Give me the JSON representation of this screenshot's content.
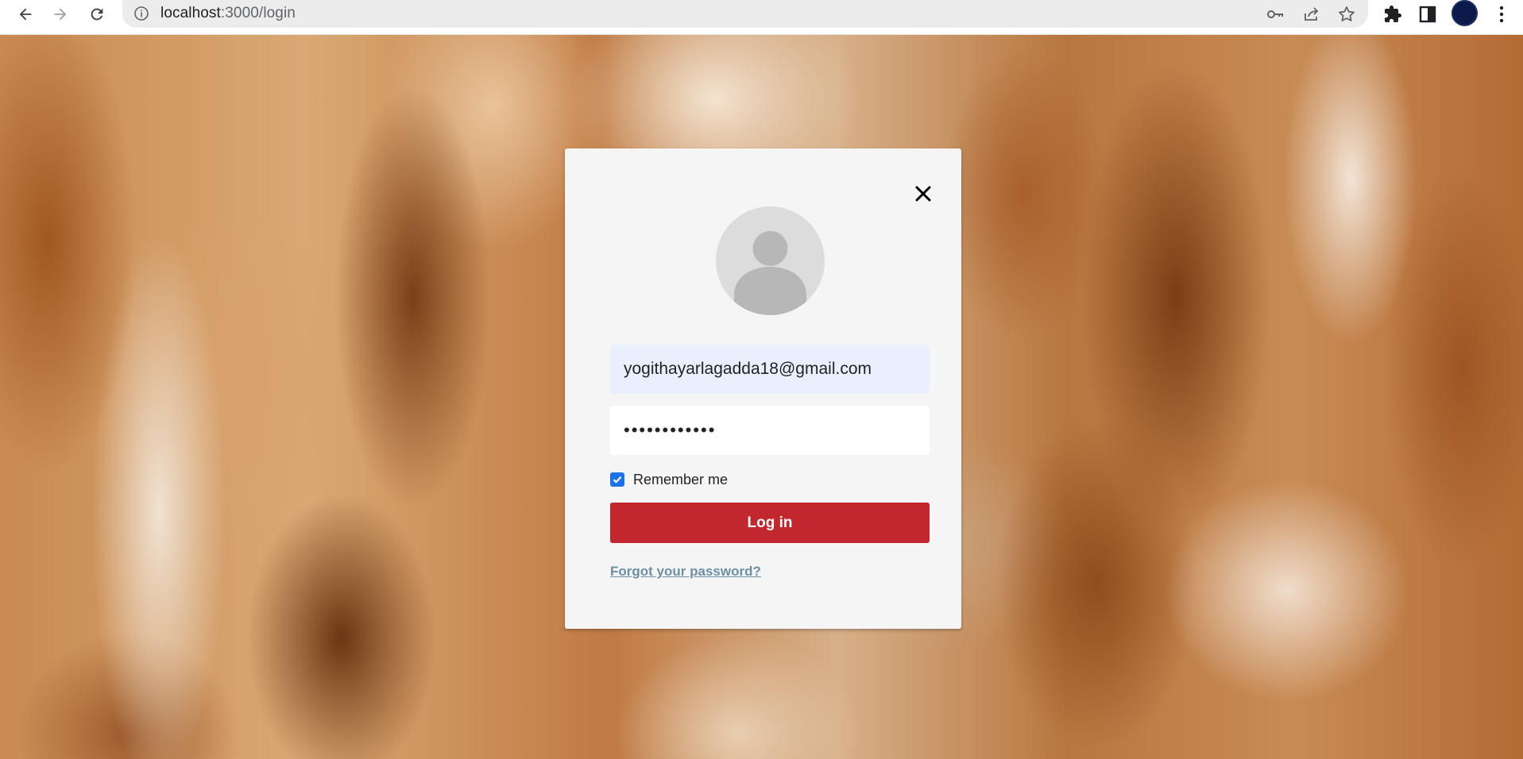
{
  "browser": {
    "url_host": "localhost",
    "url_rest": ":3000/login",
    "icons": [
      "back-arrow-icon",
      "forward-arrow-icon",
      "reload-icon",
      "info-icon",
      "key-icon",
      "share-icon",
      "star-icon",
      "extensions-icon",
      "side-panel-icon",
      "profile-avatar",
      "more-vert-icon"
    ]
  },
  "login": {
    "email_value": "yogithayarlagadda18@gmail.com",
    "password_mask": "••••••••••••",
    "remember_label": "Remember me",
    "remember_checked": true,
    "login_label": "Log in",
    "forgot_label": "Forgot your password?"
  },
  "colors": {
    "login_button": "#c1272d",
    "checkbox": "#1a73e8",
    "forgot_link": "#6d8fa6",
    "email_autofill_bg": "#e8f0fe"
  }
}
